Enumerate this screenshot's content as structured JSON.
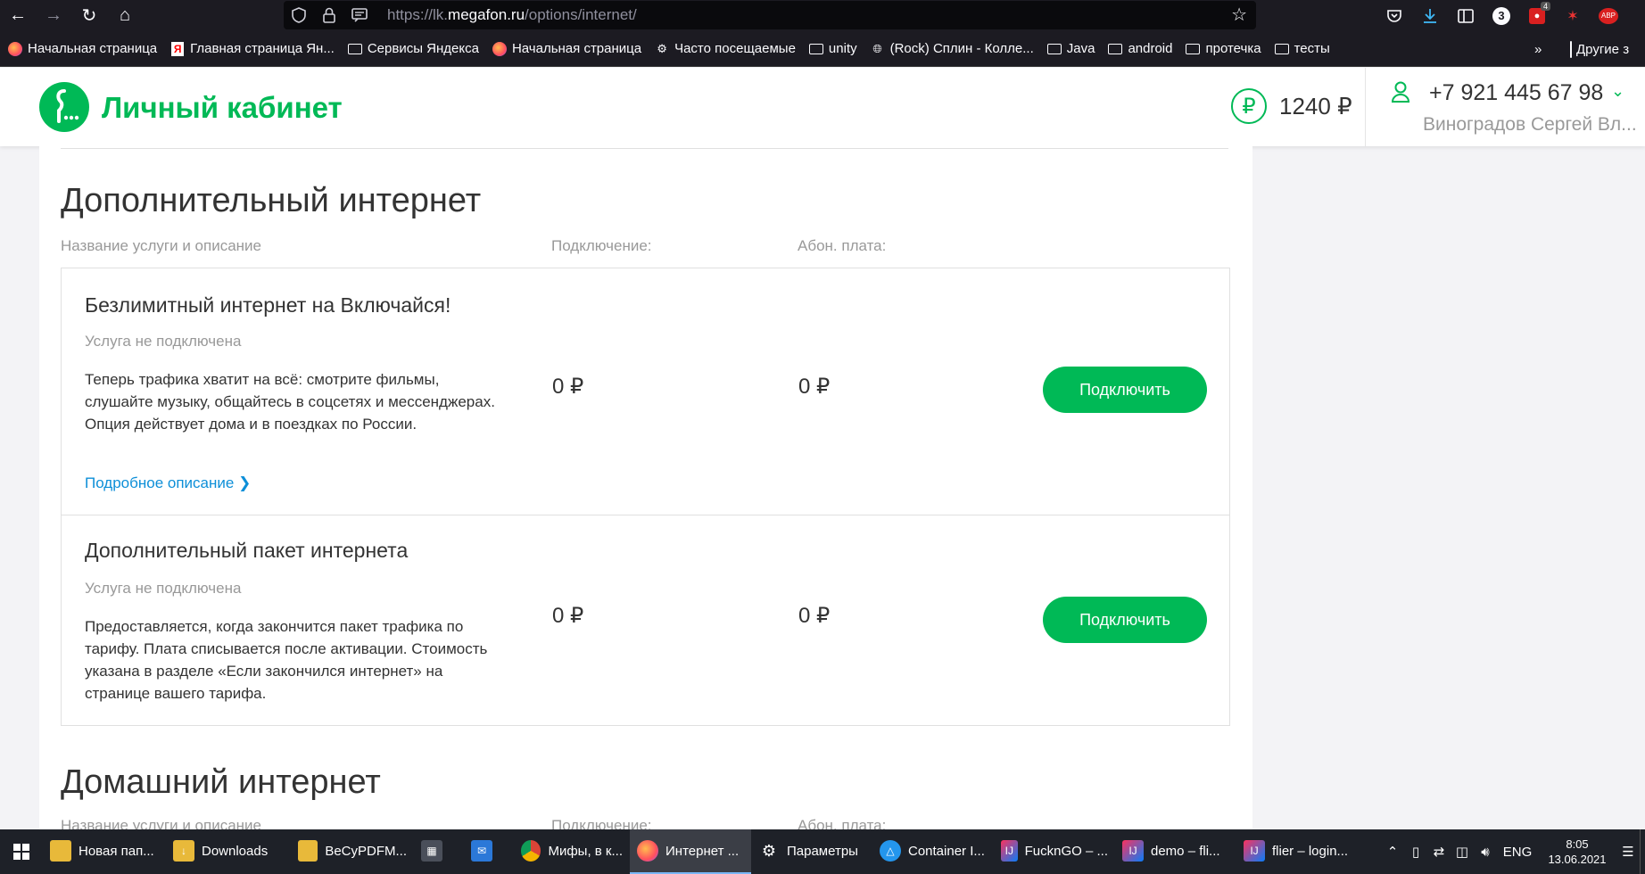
{
  "browser": {
    "url_prefix": "https://lk.",
    "url_domain": "megafon.ru",
    "url_path": "/options/internet/",
    "notification_count": "3",
    "addon_badge_count": "4",
    "abp_label": "ABP",
    "bookmarks": [
      {
        "label": "Начальная страница",
        "icon": "firefox-icon"
      },
      {
        "label": "Главная страница Ян...",
        "icon": "yandex-icon"
      },
      {
        "label": "Сервисы Яндекса",
        "icon": "folder-icon"
      },
      {
        "label": "Начальная страница",
        "icon": "firefox-icon"
      },
      {
        "label": "Часто посещаемые",
        "icon": "gear-icon"
      },
      {
        "label": "unity",
        "icon": "folder-icon"
      },
      {
        "label": "(Rock) Сплин - Колле...",
        "icon": "globe-icon"
      },
      {
        "label": "Java",
        "icon": "folder-icon"
      },
      {
        "label": "android",
        "icon": "folder-icon"
      },
      {
        "label": "протечка",
        "icon": "folder-icon"
      },
      {
        "label": "тесты",
        "icon": "folder-icon"
      }
    ],
    "other_bookmarks": "Другие з"
  },
  "header": {
    "title": "Личный кабинет",
    "balance": "1240 ₽",
    "phone": "+7 921 445 67 98",
    "user_name": "Виноградов Сергей Вл...",
    "brand_color": "#00b956"
  },
  "sections": [
    {
      "title": "Дополнительный интернет",
      "columns": [
        "Название услуги и описание",
        "Подключение:",
        "Абон. плата:"
      ],
      "options": [
        {
          "title": "Безлимитный интернет на Включайся!",
          "status": "Услуга не подключена",
          "description": "Теперь трафика хватит на всё: смотрите фильмы, слушайте музыку, общайтесь в соцсетях и мессенджерах. Опция действует дома и в поездках по России.",
          "link": "Подробное описание",
          "connection_price": "0 ₽",
          "monthly_fee": "0 ₽",
          "button": "Подключить"
        },
        {
          "title": "Дополнительный пакет интернета",
          "status": "Услуга не подключена",
          "description": "Предоставляется, когда закончится пакет трафика по тарифу. Плата списывается после активации. Стоимость указана в разделе «Если закончился интернет» на странице вашего тарифа.",
          "connection_price": "0 ₽",
          "monthly_fee": "0 ₽",
          "button": "Подключить"
        }
      ]
    },
    {
      "title": "Домашний интернет",
      "columns": [
        "Название услуги и описание",
        "Подключение:",
        "Абон. плата:"
      ]
    }
  ],
  "taskbar": {
    "tasks": [
      {
        "label": "Новая пап...",
        "icon": "folder-icon"
      },
      {
        "label": "Downloads",
        "icon": "folder-icon"
      },
      {
        "label": "BeCyPDFM...",
        "icon": "folder-icon"
      },
      {
        "label": "",
        "icon": "store-icon"
      },
      {
        "label": "",
        "icon": "mail-icon"
      },
      {
        "label": "Мифы, в к...",
        "icon": "chrome-icon"
      },
      {
        "label": "Интернет ...",
        "icon": "firefox-icon"
      },
      {
        "label": "Параметры",
        "icon": "gear-icon"
      },
      {
        "label": "Container I...",
        "icon": "docker-icon"
      },
      {
        "label": "FucknGO – ...",
        "icon": "intellij-icon"
      },
      {
        "label": "demo – fli...",
        "icon": "intellij-icon"
      },
      {
        "label": "flier – login...",
        "icon": "intellij-icon"
      }
    ],
    "language": "ENG",
    "time": "8:05",
    "date": "13.06.2021"
  }
}
